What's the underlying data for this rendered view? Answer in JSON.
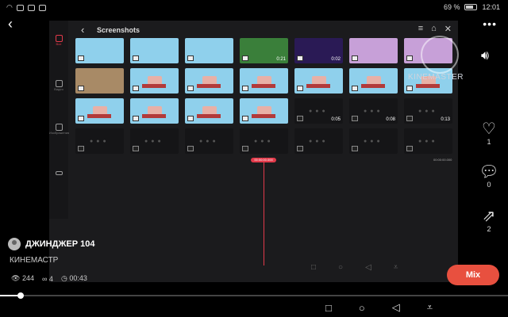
{
  "status_bar": {
    "left_icons": [
      "wifi-icon",
      "photo-icon",
      "message-icon",
      "camera-icon"
    ],
    "battery": "69 %",
    "time": "12:01"
  },
  "video": {
    "header_title": "Screenshots",
    "left_sidebar": [
      {
        "icon": "all-icon",
        "label": "Все"
      },
      {
        "icon": "video-icon",
        "label": "Видео"
      },
      {
        "icon": "image-icon",
        "label": "Изображения"
      },
      {
        "icon": "layers-icon",
        "label": ""
      }
    ],
    "thumbnails": [
      {
        "style": "sky",
        "dur": ""
      },
      {
        "style": "sky",
        "dur": ""
      },
      {
        "style": "sky",
        "dur": ""
      },
      {
        "style": "game",
        "dur": "0:21"
      },
      {
        "style": "purple",
        "dur": "0:02"
      },
      {
        "style": "pink",
        "dur": ""
      },
      {
        "style": "pink",
        "dur": ""
      },
      {
        "style": "photo",
        "dur": ""
      },
      {
        "style": "sky",
        "dur": ""
      },
      {
        "style": "sky",
        "dur": ""
      },
      {
        "style": "sky",
        "dur": ""
      },
      {
        "style": "sky",
        "dur": ""
      },
      {
        "style": "sky",
        "dur": ""
      },
      {
        "style": "sky",
        "dur": ""
      },
      {
        "style": "sky",
        "dur": ""
      },
      {
        "style": "sky",
        "dur": ""
      },
      {
        "style": "sky",
        "dur": ""
      },
      {
        "style": "sky",
        "dur": ""
      },
      {
        "style": "dark",
        "dur": "0:05"
      },
      {
        "style": "dark",
        "dur": "0:08"
      },
      {
        "style": "dark",
        "dur": "0:13"
      },
      {
        "style": "dark",
        "dur": ""
      },
      {
        "style": "dark",
        "dur": ""
      },
      {
        "style": "dark",
        "dur": ""
      },
      {
        "style": "dark",
        "dur": ""
      },
      {
        "style": "dark",
        "dur": ""
      },
      {
        "style": "dark",
        "dur": ""
      },
      {
        "style": "dark",
        "dur": ""
      }
    ],
    "playhead_time": "00:00:00.000",
    "end_time": "00:00:00.000",
    "watermark": "KINEMASTER"
  },
  "side_actions": {
    "like_count": "1",
    "comment_count": "0",
    "share_count": "2"
  },
  "author": {
    "name": "ДЖИНДЖЕР 104",
    "subtitle": "КИНЕМАСТР"
  },
  "stats": {
    "views": "244",
    "links": "4",
    "duration": "00:43"
  },
  "mix_button": "Mix",
  "progress": 0.04,
  "colors": {
    "accent": "#e8503f",
    "playhead": "#e23a4a"
  }
}
